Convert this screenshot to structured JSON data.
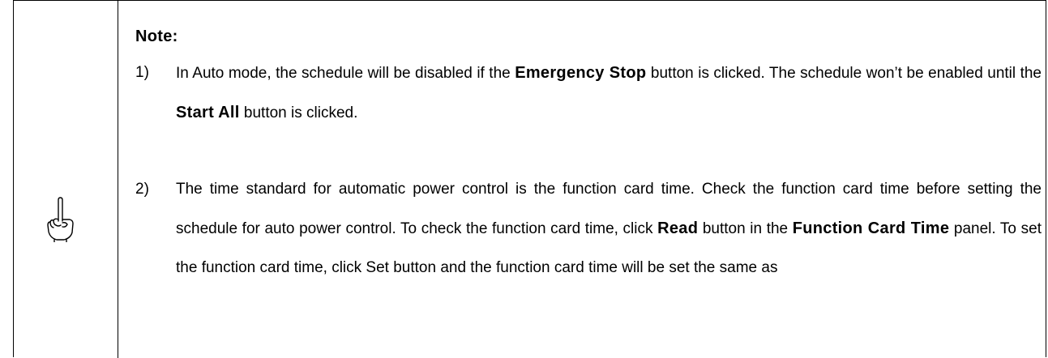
{
  "note": {
    "heading": "Note:",
    "icon": "pointing-hand-icon",
    "items": [
      {
        "number": "1)",
        "parts": [
          "In Auto mode, the schedule will be disabled if the ",
          "Emergency Stop",
          " button is clicked. The schedule won’t be enabled until the ",
          "Start All",
          " button is clicked."
        ]
      },
      {
        "number": "2)",
        "parts": [
          "The time standard for automatic power control is the function card time. Check the function card time before setting the schedule for auto power control. To check the function card time, click ",
          "Read",
          " button in the ",
          "Function Card Time",
          " panel. To set the function card time, click Set button and the function card time will be set the same as"
        ]
      }
    ]
  }
}
